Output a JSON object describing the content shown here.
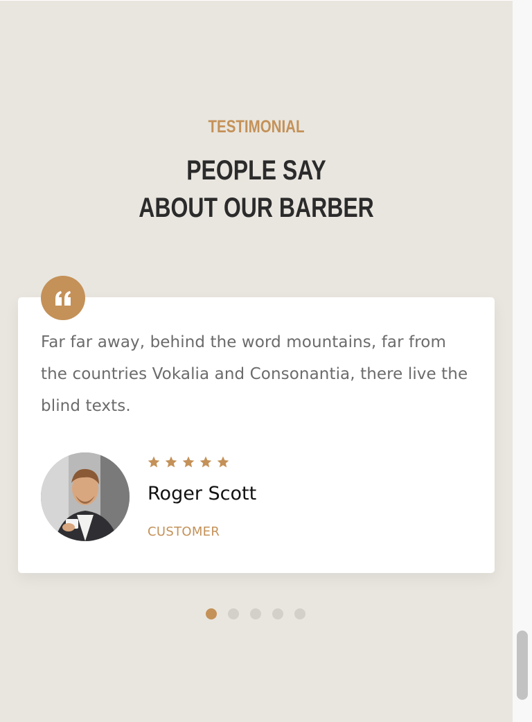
{
  "section": {
    "eyebrow": "TESTIMONIAL",
    "heading_line1": "PEOPLE SAY",
    "heading_line2": "ABOUT OUR BARBER"
  },
  "testimonial": {
    "quote": "Far far away, behind the word mountains, far from the countries Vokalia and Consonantia, there live the blind texts.",
    "rating": 5,
    "name": "Roger Scott",
    "role": "CUSTOMER",
    "icon": "quote-icon"
  },
  "carousel": {
    "slides": 5,
    "active_index": 0
  },
  "colors": {
    "accent": "#c49158",
    "background": "#e9e6df",
    "heading": "#2b2b2b",
    "body_text": "#6b6b6b"
  }
}
